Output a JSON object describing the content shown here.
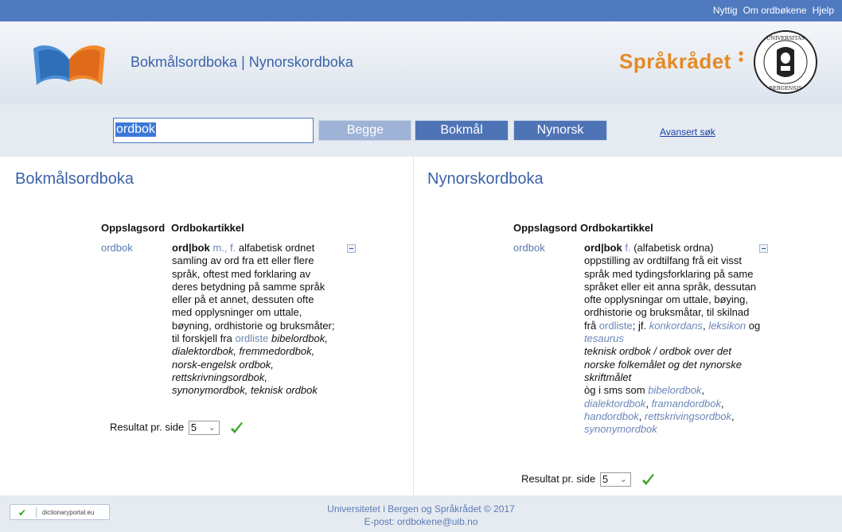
{
  "top_nav": [
    "Nyttig",
    "Om ordbøkene",
    "Hjelp"
  ],
  "header": {
    "title_bokmal": "Bokmålsordboka",
    "separator": " | ",
    "title_nynorsk": "Nynorskordboka",
    "sprak_logo": "Språkrådet",
    "seal_text": "UNIVERSITAS BERGENSIS"
  },
  "search": {
    "value": "ordbok",
    "buttons": {
      "begge": "Begge",
      "bokmal": "Bokmål",
      "nynorsk": "Nynorsk"
    },
    "advanced": "Avansert søk"
  },
  "bokmal": {
    "title": "Bokmålsordboka",
    "col_lemma": "Oppslagsord",
    "col_article": "Ordbokartikkel",
    "lemma": "ordbok",
    "headword": "ord|bok",
    "pos": "m., f.",
    "definition": "alfabetisk ordnet samling av ord fra ett eller flere språk, oftest med forklaring av deres betydning på samme språk eller på et annet, dessuten ofte med opplysninger om uttale, bøyning, ordhistorie og bruksmåter; til forskjell fra",
    "link_ordliste": "ordliste",
    "examples": "bibelordbok, dialektordbok, fremmedordbok, norsk-engelsk ordbok, rettskrivningsordbok, synonymordbok, teknisk ordbok",
    "per_page_label": "Resultat pr. side",
    "per_page_value": "5"
  },
  "nynorsk": {
    "title": "Nynorskordboka",
    "col_lemma": "Oppslagsord",
    "col_article": "Ordbokartikkel",
    "lemma": "ordbok",
    "headword": "ord|bok",
    "pos": "f.",
    "definition": "(alfabetisk ordna) oppstilling av ordtilfang frå eit visst språk med tydingsforklaring på same språket eller eit anna språk, dessutan ofte opplysningar om uttale, bøying, ordhistorie og bruksmåtar, til skilnad frå",
    "link_ordliste": "ordliste",
    "sep1": ";",
    "jf": "jf.",
    "link_konkordans": "konkordans",
    "comma1": ",",
    "link_leksikon": "leksikon",
    "og": "og",
    "link_tesaurus": "tesaurus",
    "examples": "teknisk ordbok / ordbok over det norske folkemålet og det nynorske skriftmålet",
    "sms_prefix": "òg i sms som",
    "link_bibelordbok": "bibelordbok",
    "link_dialektordbok": "dialektordbok",
    "link_framandordbok": "framandordbok",
    "link_handordbok": "handordbok",
    "link_rettskrivingsordbok": "rettskrivingsordbok",
    "link_synonymordbok": "synonymordbok",
    "per_page_label": "Resultat pr. side",
    "per_page_value": "5"
  },
  "footer": {
    "line1": "Universitetet i Bergen og Språkrådet © 2017",
    "line2": "E-post: ordbokene@uib.no",
    "badge": "dictionaryportal.eu"
  },
  "colors": {
    "topbar": "#4f7ac0",
    "accent": "#3b63a8",
    "button": "#4e74b6",
    "button_inactive": "#9fb3d6",
    "link": "#6b86b8",
    "logo_orange": "#e58a26"
  }
}
